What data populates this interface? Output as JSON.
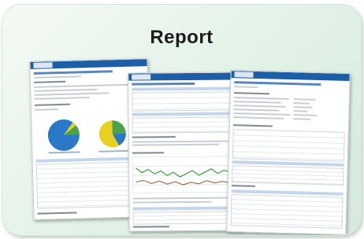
{
  "title": "Report",
  "colors": {
    "card_top": "#f3faf4",
    "card_bottom": "#d4eadb",
    "header": "#1c5ea8",
    "pie_blue": "#2a78c8",
    "pie_yellow": "#e8d020",
    "pie_green": "#4aa24a"
  },
  "documents": [
    "report-page-1",
    "report-page-2",
    "report-page-3"
  ]
}
